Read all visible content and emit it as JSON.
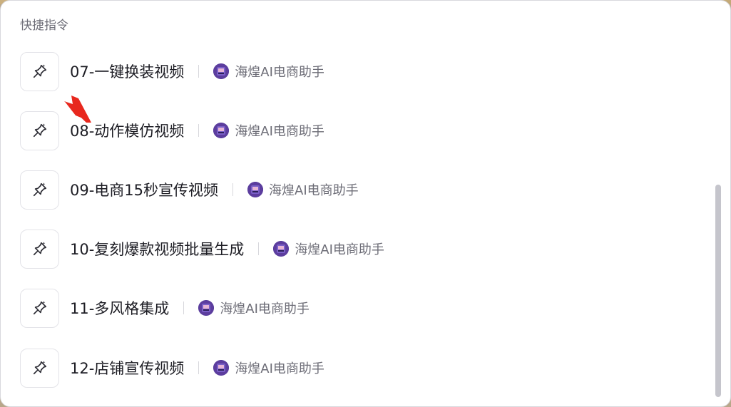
{
  "panel": {
    "section_title": "快捷指令",
    "items": [
      {
        "label": "07-一键换装视频",
        "assistant": "海煌AI电商助手",
        "icon": "sparkle-pin-icon"
      },
      {
        "label": "08-动作模仿视频",
        "assistant": "海煌AI电商助手",
        "icon": "sparkle-pin-icon"
      },
      {
        "label": "09-电商15秒宣传视频",
        "assistant": "海煌AI电商助手",
        "icon": "sparkle-pin-icon"
      },
      {
        "label": "10-复刻爆款视频批量生成",
        "assistant": "海煌AI电商助手",
        "icon": "sparkle-pin-icon"
      },
      {
        "label": "11-多风格集成",
        "assistant": "海煌AI电商助手",
        "icon": "sparkle-pin-icon"
      },
      {
        "label": "12-店铺宣传视频",
        "assistant": "海煌AI电商助手",
        "icon": "sparkle-pin-icon"
      }
    ]
  },
  "colors": {
    "arrow": "#e8281e",
    "label_text": "#1d1d24",
    "secondary_text": "#6d6d77"
  }
}
